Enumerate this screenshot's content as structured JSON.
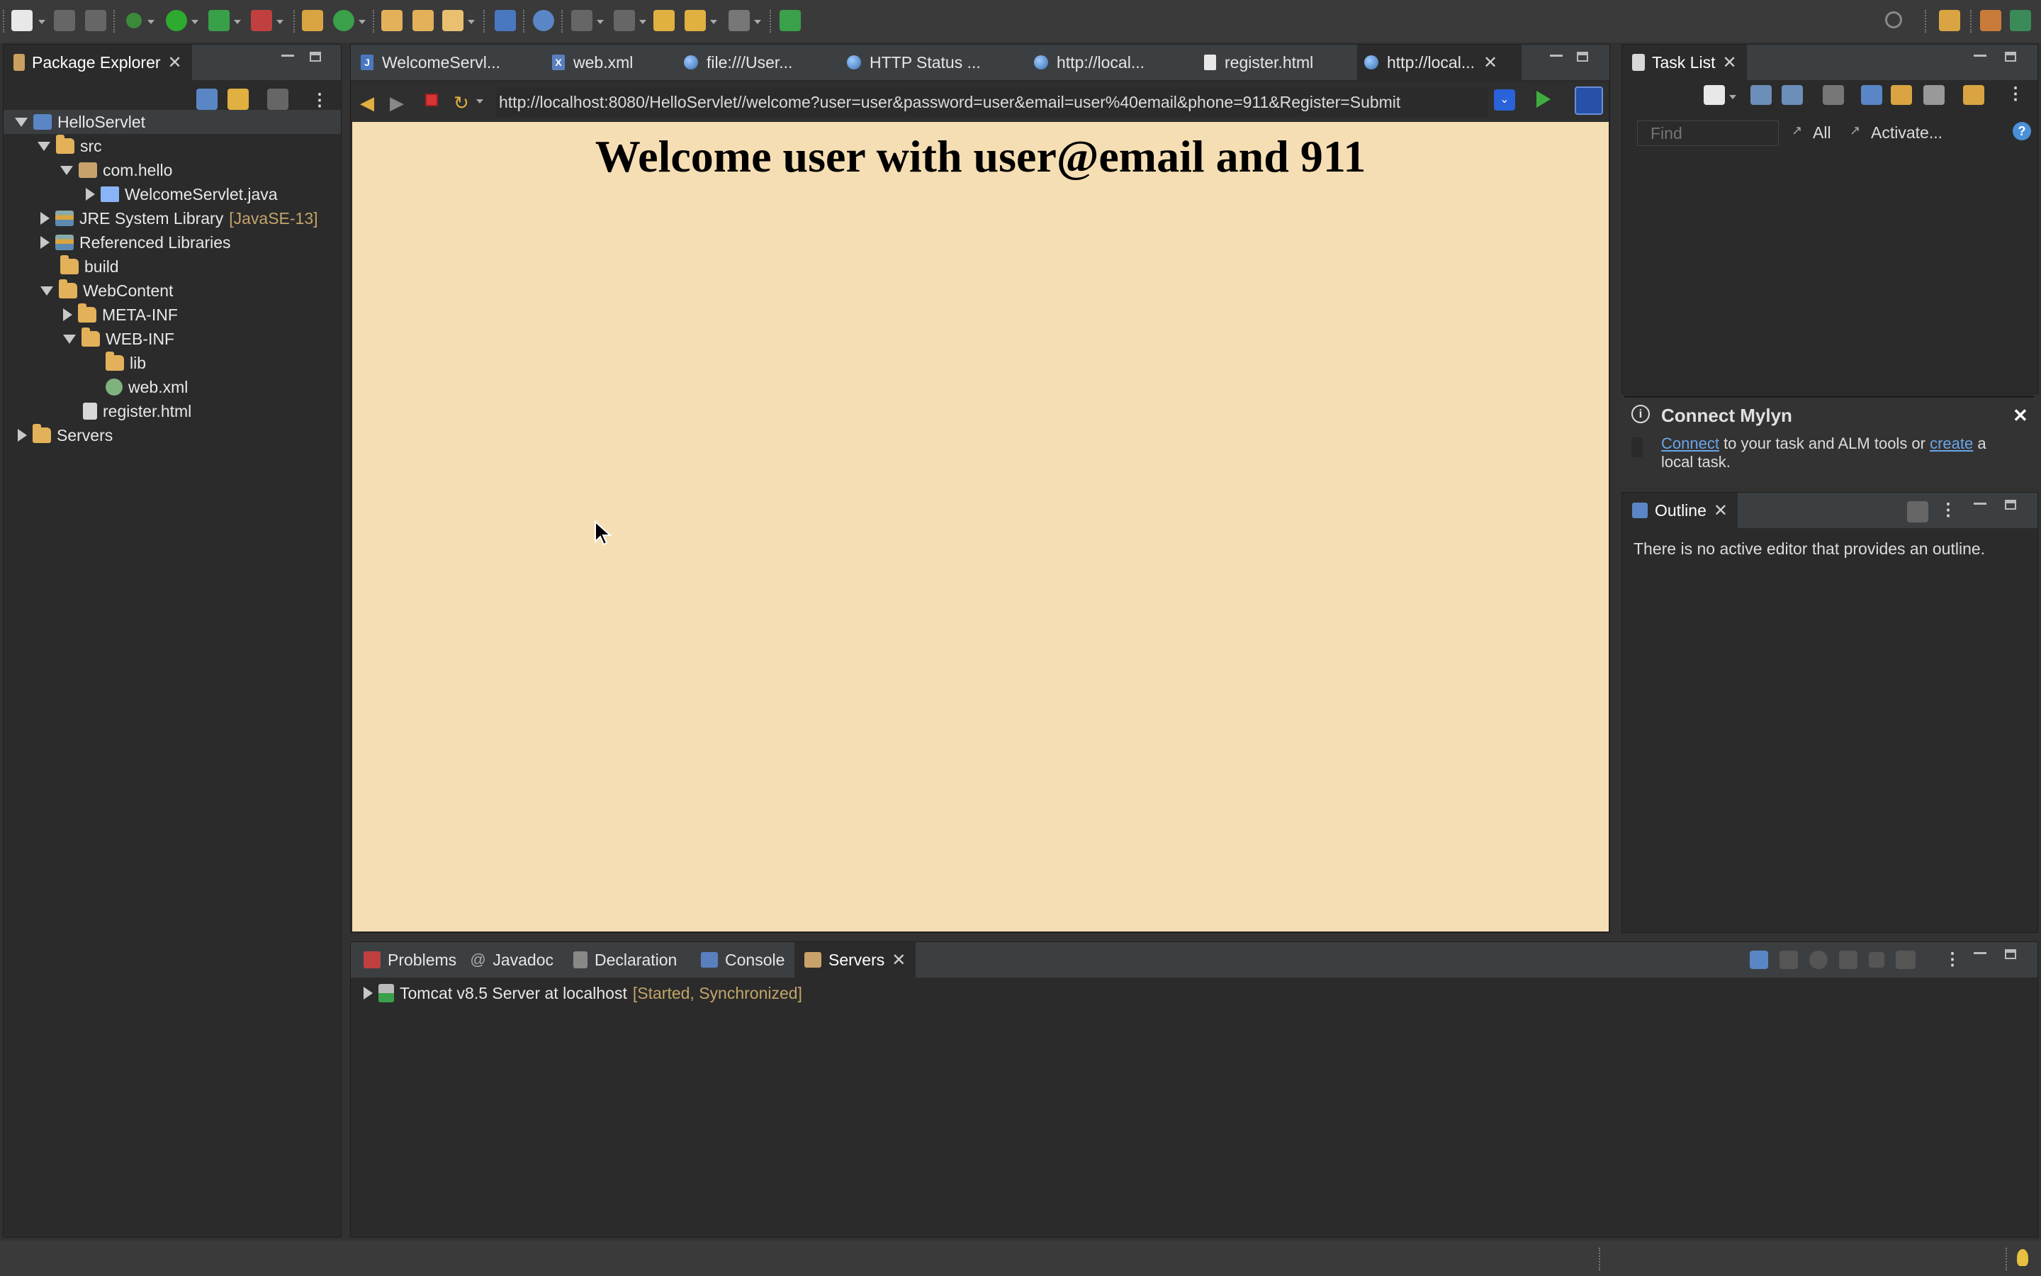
{
  "package_explorer": {
    "title": "Package Explorer",
    "tree": [
      {
        "label": "HelloServlet",
        "extra": ""
      },
      {
        "label": "src",
        "extra": ""
      },
      {
        "label": "com.hello",
        "extra": ""
      },
      {
        "label": "WelcomeServlet.java",
        "extra": ""
      },
      {
        "label": "JRE System Library",
        "extra": "[JavaSE-13]"
      },
      {
        "label": "Referenced Libraries",
        "extra": ""
      },
      {
        "label": "build",
        "extra": ""
      },
      {
        "label": "WebContent",
        "extra": ""
      },
      {
        "label": "META-INF",
        "extra": ""
      },
      {
        "label": "WEB-INF",
        "extra": ""
      },
      {
        "label": "lib",
        "extra": ""
      },
      {
        "label": "web.xml",
        "extra": ""
      },
      {
        "label": "register.html",
        "extra": ""
      },
      {
        "label": "Servers",
        "extra": ""
      }
    ]
  },
  "editor": {
    "tabs": [
      {
        "label": "WelcomeServl..."
      },
      {
        "label": "web.xml"
      },
      {
        "label": "file:///User..."
      },
      {
        "label": "HTTP Status ..."
      },
      {
        "label": "http://local..."
      },
      {
        "label": "register.html"
      },
      {
        "label": "http://local..."
      }
    ],
    "url": "http://localhost:8080/HelloServlet//welcome?user=user&password=user&email=user%40email&phone=911&Register=Submit",
    "page_heading": "Welcome user with user@email and 911"
  },
  "task_list": {
    "title": "Task List",
    "find_placeholder": "Find",
    "all_label": "All",
    "activate_label": "Activate..."
  },
  "mylyn": {
    "title": "Connect Mylyn",
    "link_connect": "Connect",
    "text_middle": " to your task and ALM tools or ",
    "link_create": "create",
    "text_end": " a",
    "text_line2": "local task."
  },
  "outline": {
    "title": "Outline",
    "message": "There is no active editor that provides an outline."
  },
  "bottom": {
    "tabs": [
      {
        "label": "Problems"
      },
      {
        "label": "Javadoc"
      },
      {
        "label": "Declaration"
      },
      {
        "label": "Console"
      },
      {
        "label": "Servers"
      }
    ],
    "server_name": "Tomcat v8.5 Server at localhost",
    "server_status": "[Started, Synchronized]"
  },
  "colors": {
    "page_background": "#f5deb3",
    "ide_background": "#323232",
    "status_highlight": "#c3a46a",
    "link": "#6aa5e8"
  }
}
